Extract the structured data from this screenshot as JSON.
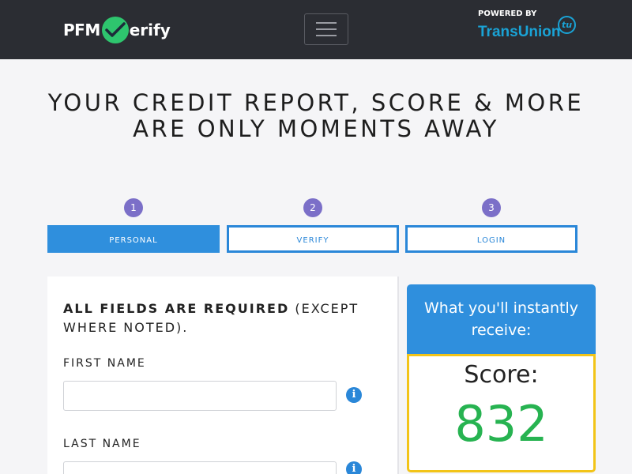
{
  "header": {
    "logo_pfm": "PFM",
    "logo_rest": "erify",
    "powered_by": "POWERED BY",
    "partner": "TransUnion",
    "partner_badge": "tu"
  },
  "headline": "YOUR CREDIT REPORT, SCORE & MORE ARE ONLY MOMENTS AWAY",
  "steps": [
    {
      "number": "1",
      "label": "PERSONAL",
      "active": true
    },
    {
      "number": "2",
      "label": "VERIFY",
      "active": false
    },
    {
      "number": "3",
      "label": "LOGIN",
      "active": false
    }
  ],
  "form": {
    "note_bold": "ALL FIELDS ARE REQUIRED",
    "note_rest": " (EXCEPT WHERE NOTED).",
    "fields": [
      {
        "label": "FIRST NAME",
        "value": "",
        "placeholder": ""
      },
      {
        "label": "LAST NAME",
        "value": "",
        "placeholder": ""
      }
    ],
    "info_glyph": "i"
  },
  "score_panel": {
    "heading": "What you'll instantly receive:",
    "label": "Score:",
    "value": "832"
  },
  "colors": {
    "header_bg": "#2b2d33",
    "accent_blue": "#2f8fdd",
    "step_circle": "#7b6fc8",
    "score_border": "#f2c418",
    "score_green": "#27b351",
    "brand_green": "#2ec56e",
    "transunion_blue": "#1aa3d6"
  }
}
